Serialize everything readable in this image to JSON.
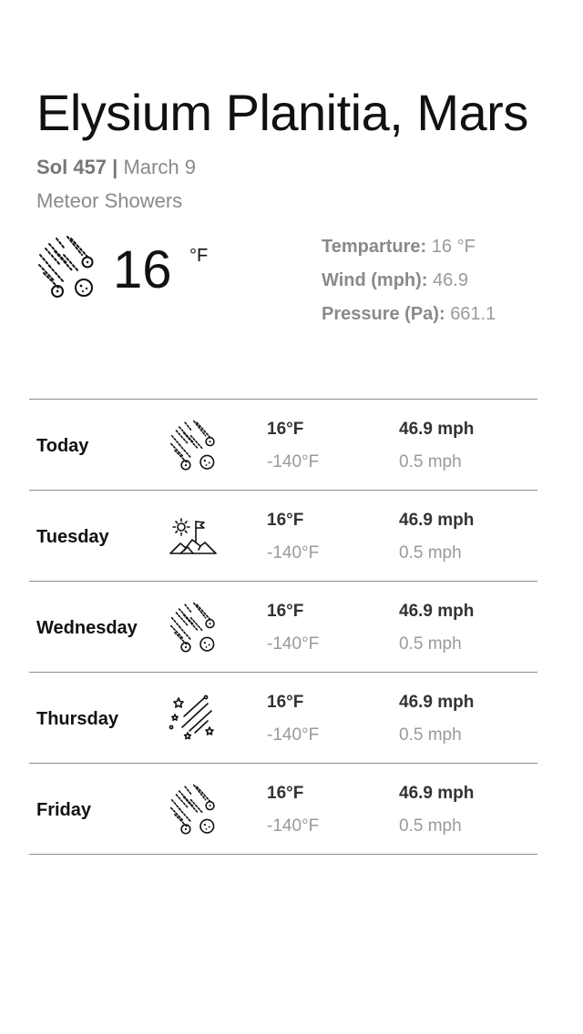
{
  "location": {
    "title": "Elysium Planitia, Mars"
  },
  "date": {
    "sol": "Sol 457",
    "separator": "|",
    "date": "March 9"
  },
  "condition": "Meteor Showers",
  "current": {
    "icon": "meteor-shower-icon",
    "temp": "16",
    "unit": "°F",
    "stats": [
      {
        "label": "Temparture:",
        "value": "16 °F"
      },
      {
        "label": "Wind (mph):",
        "value": "46.9"
      },
      {
        "label": "Pressure (Pa):",
        "value": "661.1"
      }
    ]
  },
  "forecast": [
    {
      "day": "Today",
      "icon": "meteor-shower-icon",
      "high": "16°F",
      "low": "-140°F",
      "wind_max": "46.9 mph",
      "wind_min": "0.5 mph"
    },
    {
      "day": "Tuesday",
      "icon": "sunny-landscape-flag-icon",
      "high": "16°F",
      "low": "-140°F",
      "wind_max": "46.9 mph",
      "wind_min": "0.5 mph"
    },
    {
      "day": "Wednesday",
      "icon": "meteor-shower-icon",
      "high": "16°F",
      "low": "-140°F",
      "wind_max": "46.9 mph",
      "wind_min": "0.5 mph"
    },
    {
      "day": "Thursday",
      "icon": "starry-streaks-icon",
      "high": "16°F",
      "low": "-140°F",
      "wind_max": "46.9 mph",
      "wind_min": "0.5 mph"
    },
    {
      "day": "Friday",
      "icon": "meteor-shower-icon",
      "high": "16°F",
      "low": "-140°F",
      "wind_max": "46.9 mph",
      "wind_min": "0.5 mph"
    }
  ]
}
